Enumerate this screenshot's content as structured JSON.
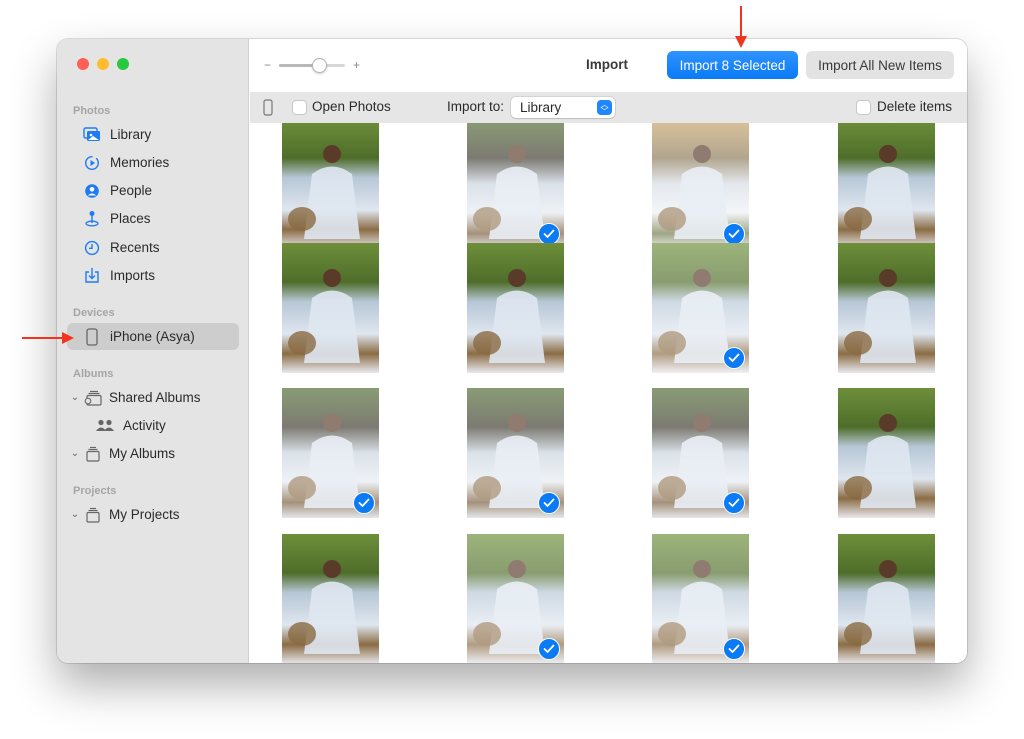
{
  "window": {
    "traffic_lights": [
      "close",
      "minimize",
      "maximize"
    ]
  },
  "sidebar": {
    "sections": [
      {
        "label": "Photos",
        "items": [
          {
            "label": "Library",
            "icon": "library-icon"
          },
          {
            "label": "Memories",
            "icon": "memories-icon"
          },
          {
            "label": "People",
            "icon": "people-icon"
          },
          {
            "label": "Places",
            "icon": "places-icon"
          },
          {
            "label": "Recents",
            "icon": "recents-icon"
          },
          {
            "label": "Imports",
            "icon": "imports-icon"
          }
        ]
      },
      {
        "label": "Devices",
        "items": [
          {
            "label": "iPhone (Asya)",
            "icon": "iphone-icon",
            "selected": true
          }
        ]
      },
      {
        "label": "Albums",
        "items": [
          {
            "label": "Shared Albums",
            "icon": "shared-albums-icon",
            "expandable": true
          },
          {
            "label": "Activity",
            "icon": "activity-icon"
          },
          {
            "label": "My Albums",
            "icon": "albums-icon",
            "expandable": true
          }
        ]
      },
      {
        "label": "Projects",
        "items": [
          {
            "label": "My Projects",
            "icon": "projects-icon",
            "expandable": true
          }
        ]
      }
    ]
  },
  "toolbar": {
    "zoom_minus": "−",
    "zoom_plus": "+",
    "zoom_level": 0.6,
    "title": "Import",
    "import_selected_label": "Import 8 Selected",
    "import_all_label": "Import All New Items",
    "accent_color": "#0a7af5"
  },
  "options_bar": {
    "open_photos_label": "Open Photos",
    "open_photos_checked": false,
    "import_to_label": "Import to:",
    "import_to_value": "Library",
    "delete_items_label": "Delete items",
    "delete_items_checked": false
  },
  "photos": {
    "columns": 4,
    "selected_count": 8,
    "rows": [
      [
        {
          "selected": false,
          "tone": "green"
        },
        {
          "selected": true,
          "tone": "dark"
        },
        {
          "selected": true,
          "tone": "warm"
        },
        {
          "selected": false,
          "tone": "green"
        }
      ],
      [
        {
          "selected": false,
          "tone": "green"
        },
        {
          "selected": false,
          "tone": "green"
        },
        {
          "selected": true,
          "tone": "green"
        },
        {
          "selected": false,
          "tone": "green"
        }
      ],
      [
        {
          "selected": true,
          "tone": "dark"
        },
        {
          "selected": true,
          "tone": "dark"
        },
        {
          "selected": true,
          "tone": "dark"
        },
        {
          "selected": false,
          "tone": "green"
        }
      ],
      [
        {
          "selected": false,
          "tone": "green"
        },
        {
          "selected": true,
          "tone": "green"
        },
        {
          "selected": true,
          "tone": "green"
        },
        {
          "selected": false,
          "tone": "green"
        }
      ]
    ]
  },
  "annotations": {
    "arrow_color": "#f0341e"
  }
}
